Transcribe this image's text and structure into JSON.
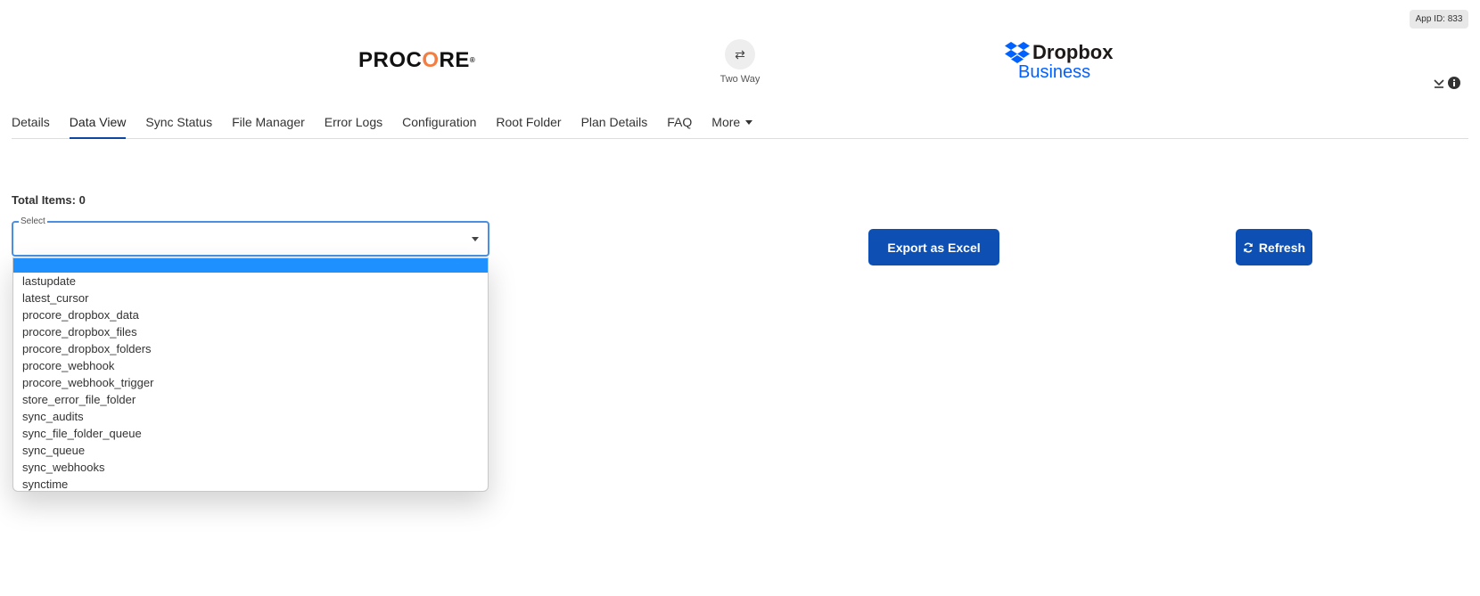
{
  "app_id": "App ID: 833",
  "logos": {
    "left": "PROCORE",
    "right_word": "Dropbox",
    "right_sub": "Business"
  },
  "sync": {
    "label": "Two Way",
    "icon": "swap-arrows-icon"
  },
  "tabs": [
    {
      "label": "Details"
    },
    {
      "label": "Data View",
      "active": true
    },
    {
      "label": "Sync Status"
    },
    {
      "label": "File Manager"
    },
    {
      "label": "Error Logs"
    },
    {
      "label": "Configuration"
    },
    {
      "label": "Root Folder"
    },
    {
      "label": "Plan Details"
    },
    {
      "label": "FAQ"
    },
    {
      "label": "More"
    }
  ],
  "total_items": "Total Items: 0",
  "select": {
    "legend": "Select",
    "value": "",
    "options": [
      "",
      "lastupdate",
      "latest_cursor",
      "procore_dropbox_data",
      "procore_dropbox_files",
      "procore_dropbox_folders",
      "procore_webhook",
      "procore_webhook_trigger",
      "store_error_file_folder",
      "sync_audits",
      "sync_file_folder_queue",
      "sync_queue",
      "sync_webhooks",
      "synctime"
    ]
  },
  "buttons": {
    "export": "Export as Excel",
    "refresh": "Refresh"
  },
  "colors": {
    "primary_button": "#0d4fb3",
    "tab_underline": "#0d47a1",
    "dropdown_highlight": "#1e90ff",
    "dropbox_blue": "#0061fe",
    "procore_orange": "#f47e42"
  }
}
